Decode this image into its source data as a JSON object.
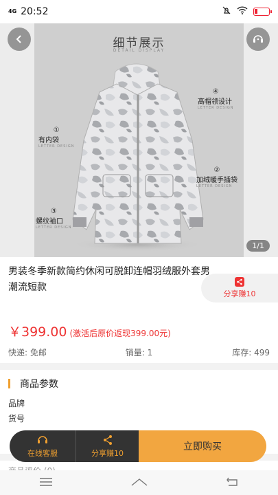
{
  "status": {
    "network": "4G",
    "time": "20:52"
  },
  "hero": {
    "detail_title": "细节展示",
    "detail_sub": "DETAIL DISPLAY",
    "callouts": [
      {
        "num": "④",
        "label": "高帽领设计",
        "sub": "LETTER DESIGN"
      },
      {
        "num": "①",
        "label": "有内袋",
        "sub": "LETTER DESIGN"
      },
      {
        "num": "②",
        "label": "加绒暖手插袋",
        "sub": "LETTER DESIGN"
      },
      {
        "num": "③",
        "label": "螺纹袖口",
        "sub": "LETTER DESIGN"
      }
    ],
    "counter": "1/1"
  },
  "product": {
    "title": "男装冬季新款简约休闲可脱卸连帽羽绒服外套男潮流短款",
    "share_label": "分享赚10",
    "price": "￥399.00",
    "price_note": "(激活后原价返现399.00元)",
    "shipping": "快递: 免邮",
    "sales": "销量: 1",
    "stock": "库存: 499"
  },
  "params": {
    "header": "商品参数",
    "brand_label": "品牌",
    "sku_label": "货号"
  },
  "bottom_bar": {
    "cs_label": "在线客服",
    "share_label": "分享赚10",
    "buy_label": "立即购买"
  },
  "reviews_peek": "商品评价 (0)",
  "colors": {
    "accent": "#f2a640",
    "price": "#e33333",
    "dark": "#333333"
  }
}
